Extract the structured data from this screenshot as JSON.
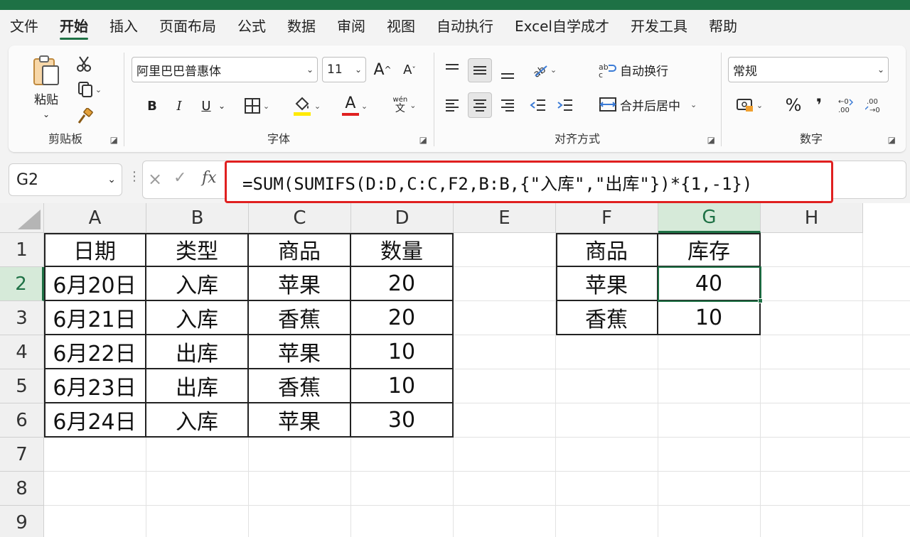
{
  "menu": [
    "文件",
    "开始",
    "插入",
    "页面布局",
    "公式",
    "数据",
    "审阅",
    "视图",
    "自动执行",
    "Excel自学成才",
    "开发工具",
    "帮助"
  ],
  "menu_active_index": 1,
  "clipboard": {
    "paste": "粘贴",
    "group": "剪贴板"
  },
  "font": {
    "name": "阿里巴巴普惠体",
    "size": "11",
    "bold": "B",
    "italic": "I",
    "underline": "U",
    "font_color_glyph": "A",
    "group": "字体",
    "grow": "A",
    "shrink": "A",
    "wen": "文"
  },
  "align": {
    "wrap": "自动换行",
    "merge": "合并后居中",
    "group": "对齐方式"
  },
  "number": {
    "format": "常规",
    "percent": "%",
    "comma": "❜",
    "group": "数字"
  },
  "name_box": "G2",
  "formula": "=SUM(SUMIFS(D:D,C:C,F2,B:B,{\"入库\",\"出库\"})*{1,-1})",
  "columns": [
    "A",
    "B",
    "C",
    "D",
    "E",
    "F",
    "G",
    "H"
  ],
  "rows": [
    "1",
    "2",
    "3",
    "4",
    "5",
    "6",
    "7",
    "8",
    "9"
  ],
  "table1": {
    "header": [
      "日期",
      "类型",
      "商品",
      "数量"
    ],
    "rows": [
      [
        "6月20日",
        "入库",
        "苹果",
        "20"
      ],
      [
        "6月21日",
        "入库",
        "香蕉",
        "20"
      ],
      [
        "6月22日",
        "出库",
        "苹果",
        "10"
      ],
      [
        "6月23日",
        "出库",
        "香蕉",
        "10"
      ],
      [
        "6月24日",
        "入库",
        "苹果",
        "30"
      ]
    ]
  },
  "table2": {
    "header": [
      "商品",
      "库存"
    ],
    "rows": [
      [
        "苹果",
        "40"
      ],
      [
        "香蕉",
        "10"
      ]
    ]
  },
  "colors": {
    "accent": "#1e7145",
    "highlight": "#e02020"
  }
}
